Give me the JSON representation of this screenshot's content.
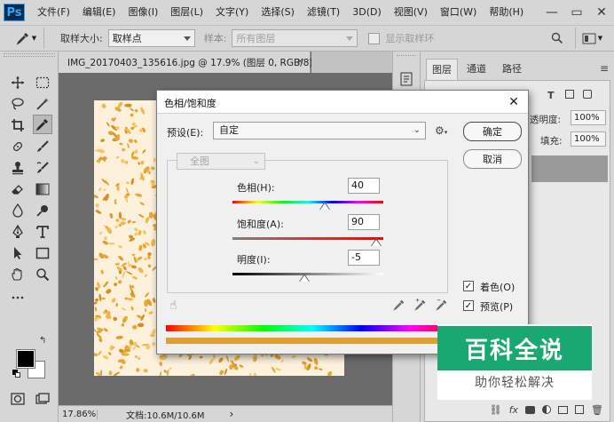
{
  "app": {
    "logo": "Ps"
  },
  "menu": {
    "items": [
      "文件(F)",
      "编辑(E)",
      "图像(I)",
      "图层(L)",
      "文字(Y)",
      "选择(S)",
      "滤镜(T)",
      "3D(D)",
      "视图(V)",
      "窗口(W)",
      "帮助(H)"
    ]
  },
  "window_controls": {
    "minimize": "—",
    "restore": "▭",
    "close": "✕"
  },
  "options_bar": {
    "sample_size_label": "取样大小:",
    "sample_size_value": "取样点",
    "sample_label": "样本:",
    "sample_value": "所有图层",
    "show_ring_label": "显示取样环"
  },
  "document": {
    "tab_title": "IMG_20170403_135616.jpg @ 17.9% (图层 0, RGB/8) *",
    "tab_close": "×",
    "zoom": "17.86%",
    "doc_info": "文档:10.6M/10.6M",
    "status_arrow": "›"
  },
  "panels": {
    "tabs": [
      "图层",
      "通道",
      "路径"
    ],
    "opacity_label": "透明度:",
    "opacity_value": "100%",
    "fill_label": "填充:",
    "fill_value": "100%",
    "footer_icons": [
      "link-icon",
      "fx-icon",
      "mask-icon",
      "adjustment-icon",
      "group-icon",
      "new-layer-icon",
      "trash-icon"
    ]
  },
  "dialog": {
    "title": "色相/饱和度",
    "close": "✕",
    "preset_label": "预设(E):",
    "preset_value": "自定",
    "channel_value": "全图",
    "ok_label": "确定",
    "cancel_label": "取消",
    "hue_label": "色相(H):",
    "hue_value": "40",
    "saturation_label": "饱和度(A):",
    "saturation_value": "90",
    "lightness_label": "明度(I):",
    "lightness_value": "-5",
    "colorize_label": "着色(O)",
    "colorize_checked": true,
    "preview_label": "预览(P)",
    "preview_checked": true,
    "hue_position": 0.61,
    "saturation_position": 0.95,
    "lightness_position": 0.475
  },
  "colors": {
    "foreground": "#000000",
    "background": "#ffffff",
    "colorize_bar": "#e0a030"
  },
  "watermark": {
    "main": "百科全说",
    "sub": "助你轻松解决",
    "color": "#19a872"
  }
}
